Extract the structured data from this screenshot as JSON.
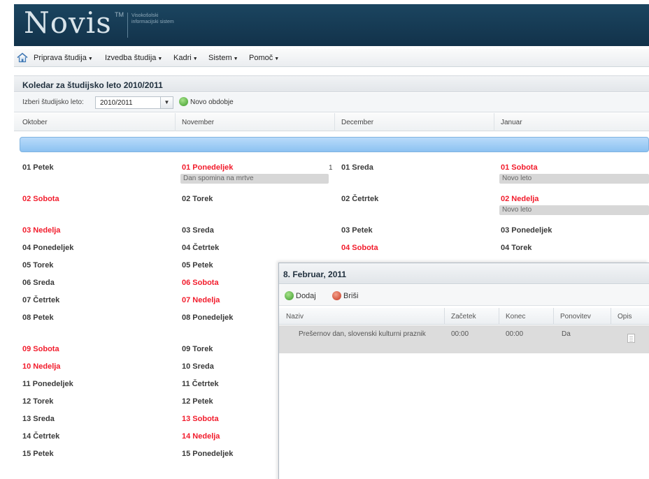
{
  "app": {
    "logo": "Novis",
    "logo_tm": "TM",
    "logo_subtitle": "Visokošolski informacijski sistem"
  },
  "menu": {
    "items": [
      {
        "label": "Priprava študija"
      },
      {
        "label": "Izvedba študija"
      },
      {
        "label": "Kadri"
      },
      {
        "label": "Sistem"
      },
      {
        "label": "Pomoč"
      }
    ]
  },
  "panel": {
    "title": "Koledar za študijsko leto 2010/2011"
  },
  "toolbar": {
    "year_label": "Izberi študijsko leto:",
    "year_value": "2010/2011",
    "new_period_label": "Novo obdobje"
  },
  "months": [
    "Oktober",
    "November",
    "December",
    "Januar"
  ],
  "calendar": {
    "oktober": [
      {
        "label": "01 Petek",
        "weekend": false
      },
      {
        "label": "02 Sobota",
        "weekend": true
      },
      {
        "label": "03 Nedelja",
        "weekend": true
      },
      {
        "label": "04 Ponedeljek",
        "weekend": false
      },
      {
        "label": "05 Torek",
        "weekend": false
      },
      {
        "label": "06 Sreda",
        "weekend": false
      },
      {
        "label": "07 Četrtek",
        "weekend": false
      },
      {
        "label": "08 Petek",
        "weekend": false
      },
      {
        "label": "09 Sobota",
        "weekend": true
      },
      {
        "label": "10 Nedelja",
        "weekend": true
      },
      {
        "label": "11 Ponedeljek",
        "weekend": false
      },
      {
        "label": "12 Torek",
        "weekend": false
      },
      {
        "label": "13 Sreda",
        "weekend": false
      },
      {
        "label": "14 Četrtek",
        "weekend": false
      },
      {
        "label": "15 Petek",
        "weekend": false
      }
    ],
    "november": [
      {
        "label": "01 Ponedeljek",
        "weekend": true,
        "event": "Dan spomina na mrtve",
        "marker": "1"
      },
      {
        "label": "02 Torek",
        "weekend": false
      },
      {
        "label": "03 Sreda",
        "weekend": false
      },
      {
        "label": "04 Četrtek",
        "weekend": false
      },
      {
        "label": "05 Petek",
        "weekend": false
      },
      {
        "label": "06 Sobota",
        "weekend": true
      },
      {
        "label": "07 Nedelja",
        "weekend": true
      },
      {
        "label": "08 Ponedeljek",
        "weekend": false
      },
      {
        "label": "09 Torek",
        "weekend": false
      },
      {
        "label": "10 Sreda",
        "weekend": false
      },
      {
        "label": "11 Četrtek",
        "weekend": false
      },
      {
        "label": "12 Petek",
        "weekend": false
      },
      {
        "label": "13 Sobota",
        "weekend": true
      },
      {
        "label": "14 Nedelja",
        "weekend": true
      },
      {
        "label": "15 Ponedeljek",
        "weekend": false
      }
    ],
    "december": [
      {
        "label": "01 Sreda",
        "weekend": false
      },
      {
        "label": "02 Četrtek",
        "weekend": false
      },
      {
        "label": "03 Petek",
        "weekend": false
      },
      {
        "label": "04 Sobota",
        "weekend": true
      }
    ],
    "januar": [
      {
        "label": "01 Sobota",
        "weekend": true,
        "event": "Novo leto"
      },
      {
        "label": "02 Nedelja",
        "weekend": true,
        "event": "Novo leto"
      },
      {
        "label": "03 Ponedeljek",
        "weekend": false
      },
      {
        "label": "04 Torek",
        "weekend": false
      }
    ]
  },
  "popup": {
    "title": "8. Februar, 2011",
    "add_label": "Dodaj",
    "delete_label": "Briši",
    "columns": [
      "Naziv",
      "Začetek",
      "Konec",
      "Ponovitev",
      "Opis"
    ],
    "rows": [
      {
        "naziv": "Prešernov dan, slovenski kulturni praznik",
        "zacetek": "00:00",
        "konec": "00:00",
        "ponovitev": "Da"
      }
    ]
  }
}
